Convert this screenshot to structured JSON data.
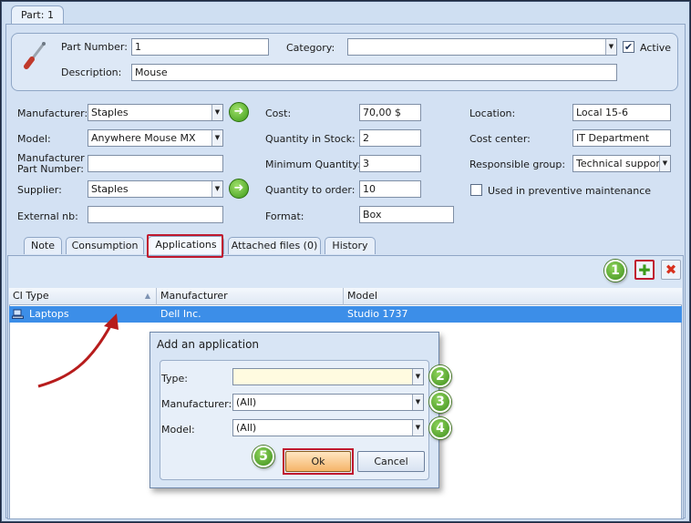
{
  "window": {
    "tab_label": "Part: 1"
  },
  "header": {
    "part_number_label": "Part Number:",
    "part_number_value": "1",
    "category_label": "Category:",
    "category_value": "",
    "active_label": "Active",
    "active_checked": true,
    "description_label": "Description:",
    "description_value": "Mouse"
  },
  "left_fields": {
    "manufacturer_label": "Manufacturer:",
    "manufacturer_value": "Staples",
    "model_label": "Model:",
    "model_value": "Anywhere Mouse MX",
    "mfr_part_label_1": "Manufacturer",
    "mfr_part_label_2": "Part Number:",
    "mfr_part_value": "",
    "supplier_label": "Supplier:",
    "supplier_value": "Staples",
    "external_label": "External nb:",
    "external_value": ""
  },
  "mid_fields": {
    "cost_label": "Cost:",
    "cost_value": "70,00 $",
    "qty_stock_label": "Quantity in Stock:",
    "qty_stock_value": "2",
    "min_qty_label": "Minimum Quantity:",
    "min_qty_value": "3",
    "qty_order_label": "Quantity to order:",
    "qty_order_value": "10",
    "format_label": "Format:",
    "format_value": "Box"
  },
  "right_fields": {
    "location_label": "Location:",
    "location_value": "Local 15-6",
    "cost_center_label": "Cost center:",
    "cost_center_value": "IT Department",
    "resp_group_label": "Responsible group:",
    "resp_group_value": "Technical support",
    "preventive_label": "Used in preventive maintenance",
    "preventive_checked": false
  },
  "tabs": [
    {
      "label": "Note"
    },
    {
      "label": "Consumption"
    },
    {
      "label": "Applications"
    },
    {
      "label": "Attached files (0)"
    },
    {
      "label": "History"
    }
  ],
  "grid": {
    "columns": [
      "CI Type",
      "Manufacturer",
      "Model"
    ],
    "rows": [
      {
        "ci_type": "Laptops",
        "manufacturer": "Dell Inc.",
        "model": "Studio 1737"
      }
    ]
  },
  "dialog": {
    "title": "Add an application",
    "type_label": "Type:",
    "type_value": "",
    "manufacturer_label": "Manufacturer:",
    "manufacturer_value": "(All)",
    "model_label": "Model:",
    "model_value": "(All)",
    "ok_label": "Ok",
    "cancel_label": "Cancel"
  },
  "badges": [
    "1",
    "2",
    "3",
    "4",
    "5"
  ],
  "icons": {
    "part": "wrench-screwdriver-icon",
    "go": "arrow-right-circle-icon",
    "add": "plus-icon",
    "delete": "x-icon",
    "laptop": "laptop-icon",
    "sort": "sort-ascending-icon"
  },
  "colors": {
    "selection": "#3c8ee8",
    "highlight": "#c0192f",
    "badge_green": "#3f8f1d",
    "ok_button": "#f5b469"
  }
}
